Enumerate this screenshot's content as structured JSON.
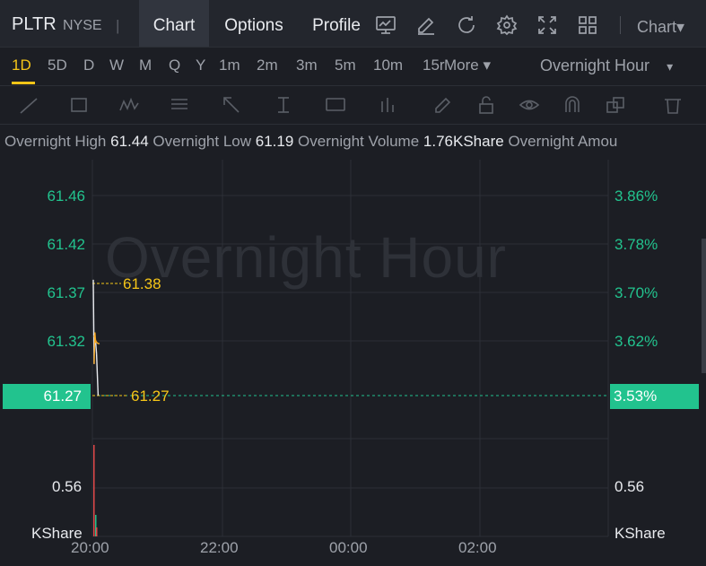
{
  "header": {
    "ticker": "PLTR",
    "exchange": "NYSE",
    "separator": "|",
    "tabs": [
      {
        "label": "Chart"
      },
      {
        "label": "Options"
      },
      {
        "label": "Profile"
      }
    ],
    "icons": [
      "trend-chart-icon",
      "edit-icon",
      "refresh-icon",
      "settings-icon",
      "fullscreen-icon",
      "grid-layout-icon"
    ],
    "chart_menu_label": "Chart▾"
  },
  "periods": {
    "items": [
      "1D",
      "5D",
      "D",
      "W",
      "M",
      "Q",
      "Y",
      "1m",
      "2m",
      "3m",
      "5m",
      "10m",
      "15r"
    ],
    "more_label": "More ▾",
    "active": "1D",
    "session_label": "Overnight Hour",
    "session_caret": "▾"
  },
  "stats": {
    "overnight_high_label": "Overnight High",
    "overnight_high": "61.44",
    "overnight_low_label": "Overnight Low",
    "overnight_low": "61.19",
    "overnight_volume_label": "Overnight Volume",
    "overnight_volume": "1.76KShare",
    "overnight_amount_label": "Overnight Amou"
  },
  "chart": {
    "watermark": "Overnight Hour",
    "y_left": [
      "61.46",
      "61.42",
      "61.37",
      "61.32"
    ],
    "y_right": [
      "3.86%",
      "3.78%",
      "3.70%",
      "3.62%"
    ],
    "current_price": "61.27",
    "current_change": "3.53%",
    "high_label": "61.38",
    "current_label": "61.27",
    "volume_left": "0.56",
    "volume_right": "0.56",
    "volume_unit_left": "KShare",
    "volume_unit_right": "KShare",
    "x_ticks": [
      "20:00",
      "22:00",
      "00:00",
      "02:00"
    ],
    "up_color": "#22c38e",
    "down_color": "#e04848",
    "accent_color": "#f5c518"
  },
  "chart_data": {
    "type": "line",
    "title": "",
    "x": [
      "20:00",
      "20:01",
      "20:02",
      "20:03",
      "20:04",
      "20:05",
      "20:06"
    ],
    "series": [
      {
        "values": [
          61.38,
          61.3,
          61.33,
          61.32,
          61.31,
          61.29,
          61.27
        ]
      }
    ],
    "ylim": [
      61.27,
      61.46
    ],
    "x_ticks": [
      "20:00",
      "22:00",
      "00:00",
      "02:00"
    ],
    "y_ticks": [
      61.46,
      61.42,
      61.37,
      61.32,
      61.27
    ],
    "volume_ylim": [
      0,
      0.56
    ],
    "grid": true
  }
}
